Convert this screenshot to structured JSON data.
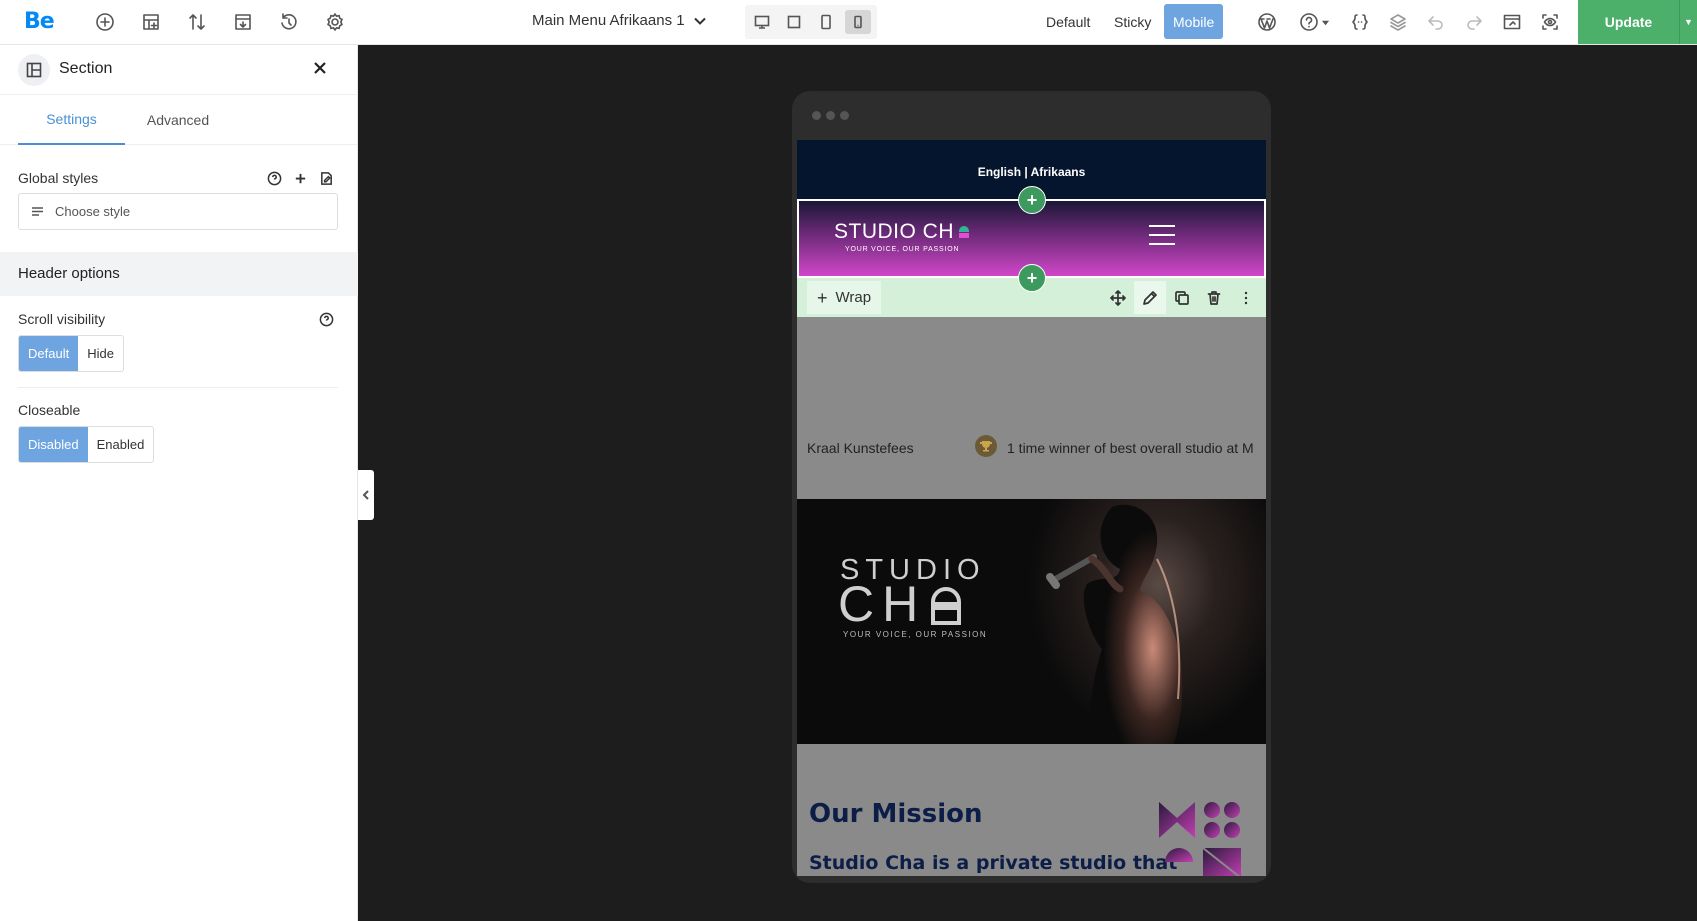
{
  "app": {
    "logo": "Be",
    "document_title": "Main Menu Afrikaans 1",
    "update_label": "Update"
  },
  "toolbar": {
    "icons": [
      "add-icon",
      "layout-icon",
      "sort-icon",
      "template-icon",
      "history-icon",
      "settings-icon"
    ],
    "devices": [
      {
        "name": "desktop-icon",
        "active": false
      },
      {
        "name": "laptop-icon",
        "active": false
      },
      {
        "name": "tablet-icon",
        "active": false
      },
      {
        "name": "mobile-icon",
        "active": true
      }
    ],
    "states": [
      {
        "label": "Default",
        "active": false
      },
      {
        "label": "Sticky",
        "active": false
      },
      {
        "label": "Mobile",
        "active": true
      }
    ],
    "right_icons": [
      "wordpress-icon",
      "help-icon",
      "css-icon",
      "layers-icon",
      "undo-icon",
      "redo-icon",
      "preview-icon",
      "eye-icon"
    ]
  },
  "panel": {
    "title": "Section",
    "tabs": [
      {
        "label": "Settings",
        "active": true
      },
      {
        "label": "Advanced",
        "active": false
      }
    ],
    "global_styles_label": "Global styles",
    "choose_style_placeholder": "Choose style",
    "header_options_label": "Header options",
    "scroll_visibility_label": "Scroll visibility",
    "scroll_visibility_options": [
      {
        "label": "Default",
        "selected": true
      },
      {
        "label": "Hide",
        "selected": false
      }
    ],
    "closeable_label": "Closeable",
    "closeable_options": [
      {
        "label": "Disabled",
        "selected": true
      },
      {
        "label": "Enabled",
        "selected": false
      }
    ]
  },
  "preview": {
    "language_bar": "English | Afrikaans",
    "brand_name": "STUDIO CH",
    "brand_tagline": "YOUR VOICE, OUR PASSION",
    "wrap_label": "Wrap",
    "ticker_left": "Kraal Kunstefees",
    "ticker_right": "1 time winner of best overall studio at M",
    "hero_studio": "STUDIO",
    "hero_cha": "CH",
    "hero_tagline": "YOUR VOICE, OUR PASSION",
    "mission_title": "Our Mission",
    "mission_text": "Studio Cha is a private studio that"
  },
  "colors": {
    "accent": "#6ea5e0",
    "update_green": "#4caf6a",
    "wrap_bg": "#d4f0d9",
    "mission_text": "#0c1e47",
    "logo_blue": "#0089f7"
  }
}
